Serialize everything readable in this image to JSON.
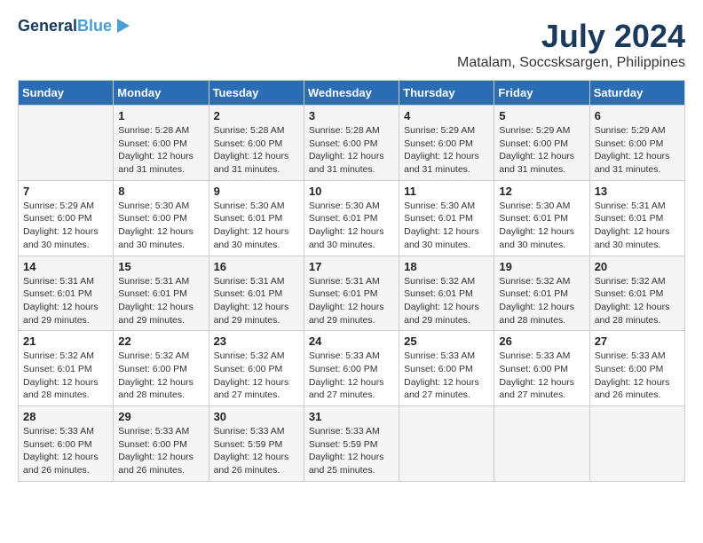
{
  "logo": {
    "line1": "General",
    "line2": "Blue"
  },
  "title": {
    "month": "July 2024",
    "location": "Matalam, Soccsksargen, Philippines"
  },
  "days_of_week": [
    "Sunday",
    "Monday",
    "Tuesday",
    "Wednesday",
    "Thursday",
    "Friday",
    "Saturday"
  ],
  "weeks": [
    {
      "days": [
        {
          "number": "",
          "info": ""
        },
        {
          "number": "1",
          "info": "Sunrise: 5:28 AM\nSunset: 6:00 PM\nDaylight: 12 hours and 31 minutes."
        },
        {
          "number": "2",
          "info": "Sunrise: 5:28 AM\nSunset: 6:00 PM\nDaylight: 12 hours and 31 minutes."
        },
        {
          "number": "3",
          "info": "Sunrise: 5:28 AM\nSunset: 6:00 PM\nDaylight: 12 hours and 31 minutes."
        },
        {
          "number": "4",
          "info": "Sunrise: 5:29 AM\nSunset: 6:00 PM\nDaylight: 12 hours and 31 minutes."
        },
        {
          "number": "5",
          "info": "Sunrise: 5:29 AM\nSunset: 6:00 PM\nDaylight: 12 hours and 31 minutes."
        },
        {
          "number": "6",
          "info": "Sunrise: 5:29 AM\nSunset: 6:00 PM\nDaylight: 12 hours and 31 minutes."
        }
      ]
    },
    {
      "days": [
        {
          "number": "7",
          "info": "Sunrise: 5:29 AM\nSunset: 6:00 PM\nDaylight: 12 hours and 30 minutes."
        },
        {
          "number": "8",
          "info": "Sunrise: 5:30 AM\nSunset: 6:00 PM\nDaylight: 12 hours and 30 minutes."
        },
        {
          "number": "9",
          "info": "Sunrise: 5:30 AM\nSunset: 6:01 PM\nDaylight: 12 hours and 30 minutes."
        },
        {
          "number": "10",
          "info": "Sunrise: 5:30 AM\nSunset: 6:01 PM\nDaylight: 12 hours and 30 minutes."
        },
        {
          "number": "11",
          "info": "Sunrise: 5:30 AM\nSunset: 6:01 PM\nDaylight: 12 hours and 30 minutes."
        },
        {
          "number": "12",
          "info": "Sunrise: 5:30 AM\nSunset: 6:01 PM\nDaylight: 12 hours and 30 minutes."
        },
        {
          "number": "13",
          "info": "Sunrise: 5:31 AM\nSunset: 6:01 PM\nDaylight: 12 hours and 30 minutes."
        }
      ]
    },
    {
      "days": [
        {
          "number": "14",
          "info": "Sunrise: 5:31 AM\nSunset: 6:01 PM\nDaylight: 12 hours and 29 minutes."
        },
        {
          "number": "15",
          "info": "Sunrise: 5:31 AM\nSunset: 6:01 PM\nDaylight: 12 hours and 29 minutes."
        },
        {
          "number": "16",
          "info": "Sunrise: 5:31 AM\nSunset: 6:01 PM\nDaylight: 12 hours and 29 minutes."
        },
        {
          "number": "17",
          "info": "Sunrise: 5:31 AM\nSunset: 6:01 PM\nDaylight: 12 hours and 29 minutes."
        },
        {
          "number": "18",
          "info": "Sunrise: 5:32 AM\nSunset: 6:01 PM\nDaylight: 12 hours and 29 minutes."
        },
        {
          "number": "19",
          "info": "Sunrise: 5:32 AM\nSunset: 6:01 PM\nDaylight: 12 hours and 28 minutes."
        },
        {
          "number": "20",
          "info": "Sunrise: 5:32 AM\nSunset: 6:01 PM\nDaylight: 12 hours and 28 minutes."
        }
      ]
    },
    {
      "days": [
        {
          "number": "21",
          "info": "Sunrise: 5:32 AM\nSunset: 6:01 PM\nDaylight: 12 hours and 28 minutes."
        },
        {
          "number": "22",
          "info": "Sunrise: 5:32 AM\nSunset: 6:00 PM\nDaylight: 12 hours and 28 minutes."
        },
        {
          "number": "23",
          "info": "Sunrise: 5:32 AM\nSunset: 6:00 PM\nDaylight: 12 hours and 27 minutes."
        },
        {
          "number": "24",
          "info": "Sunrise: 5:33 AM\nSunset: 6:00 PM\nDaylight: 12 hours and 27 minutes."
        },
        {
          "number": "25",
          "info": "Sunrise: 5:33 AM\nSunset: 6:00 PM\nDaylight: 12 hours and 27 minutes."
        },
        {
          "number": "26",
          "info": "Sunrise: 5:33 AM\nSunset: 6:00 PM\nDaylight: 12 hours and 27 minutes."
        },
        {
          "number": "27",
          "info": "Sunrise: 5:33 AM\nSunset: 6:00 PM\nDaylight: 12 hours and 26 minutes."
        }
      ]
    },
    {
      "days": [
        {
          "number": "28",
          "info": "Sunrise: 5:33 AM\nSunset: 6:00 PM\nDaylight: 12 hours and 26 minutes."
        },
        {
          "number": "29",
          "info": "Sunrise: 5:33 AM\nSunset: 6:00 PM\nDaylight: 12 hours and 26 minutes."
        },
        {
          "number": "30",
          "info": "Sunrise: 5:33 AM\nSunset: 5:59 PM\nDaylight: 12 hours and 26 minutes."
        },
        {
          "number": "31",
          "info": "Sunrise: 5:33 AM\nSunset: 5:59 PM\nDaylight: 12 hours and 25 minutes."
        },
        {
          "number": "",
          "info": ""
        },
        {
          "number": "",
          "info": ""
        },
        {
          "number": "",
          "info": ""
        }
      ]
    }
  ]
}
